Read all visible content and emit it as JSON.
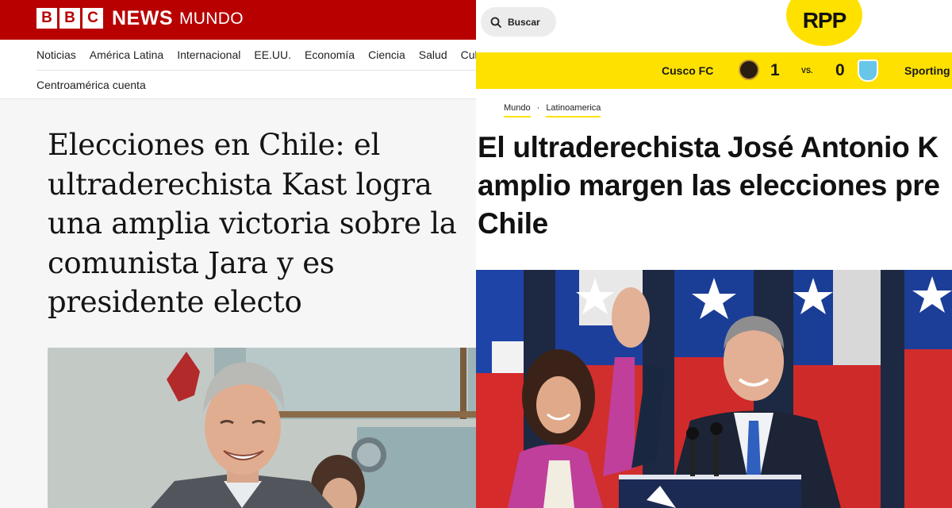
{
  "bbc": {
    "logo_letters": [
      "B",
      "B",
      "C"
    ],
    "brand_news": "NEWS",
    "brand_mundo": "MUNDO",
    "nav_items": [
      "Noticias",
      "América Latina",
      "Internacional",
      "EE.UU.",
      "Economía",
      "Ciencia",
      "Salud",
      "Cul"
    ],
    "nav_row2": "Centroamérica cuenta",
    "headline": "Elecciones en Chile: el ultraderechista Kast logra una amplia victoria sobre la comunista Jara y es presidente electo"
  },
  "rpp": {
    "search_label": "Buscar",
    "logo": "RPP",
    "scoreboard": {
      "team1": "Cusco FC",
      "score1": "1",
      "vs": "VS.",
      "score2": "0",
      "team2": "Sporting"
    },
    "breadcrumbs": [
      "Mundo",
      "Latinoamerica"
    ],
    "headline_lines": [
      "El ultraderechista José Antonio K",
      "amplio margen las elecciones pre",
      "Chile"
    ]
  },
  "colors": {
    "bbc_red": "#b80000",
    "rpp_yellow": "#ffe100"
  }
}
